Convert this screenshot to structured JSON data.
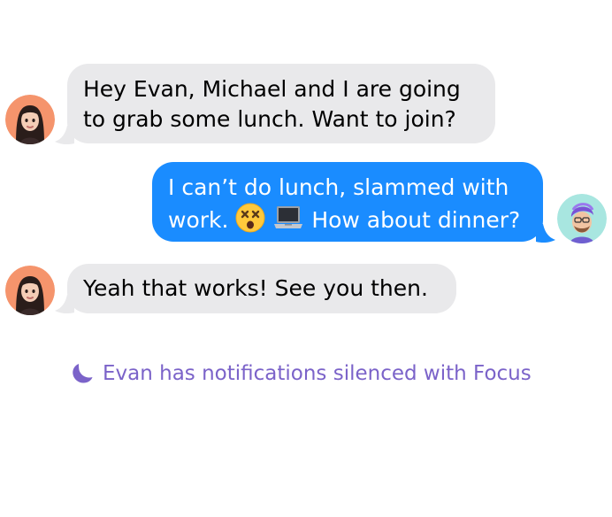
{
  "conversation": {
    "messages": [
      {
        "direction": "incoming",
        "sender_avatar": "woman-memoji",
        "lines": [
          "Hey Evan, Michael and I are going",
          "to grab some lunch. Want to join?"
        ]
      },
      {
        "direction": "outgoing",
        "sender_avatar": "man-purple-hair-memoji",
        "line1": "I can’t do lunch, slammed with",
        "line2_prefix": "work.",
        "line2_emojis": [
          "dizzy-face-emoji",
          "laptop-emoji"
        ],
        "line2_suffix": "How about dinner?"
      },
      {
        "direction": "incoming",
        "sender_avatar": "woman-memoji",
        "lines": [
          "Yeah that works! See you then."
        ]
      }
    ],
    "focus_notice": {
      "icon": "moon-icon",
      "text": "Evan has notifications silenced with Focus"
    }
  },
  "colors": {
    "incoming_bubble": "#e9e9eb",
    "outgoing_bubble": "#1a8cff",
    "focus_text": "#7b63c9",
    "avatar_bg_woman": "#f5946c",
    "avatar_bg_man": "#a8e6e0"
  }
}
